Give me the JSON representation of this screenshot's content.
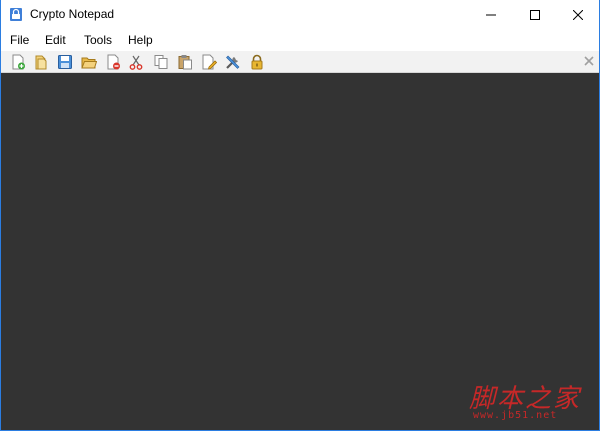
{
  "window": {
    "title": "Crypto Notepad",
    "controls": [
      "minimize-icon",
      "maximize-icon",
      "close-icon"
    ]
  },
  "menu": {
    "items": [
      {
        "label": "File"
      },
      {
        "label": "Edit"
      },
      {
        "label": "Tools"
      },
      {
        "label": "Help"
      }
    ]
  },
  "toolbar": {
    "buttons": [
      "new-file-icon",
      "open-file-icon",
      "save-icon",
      "open-folder-icon",
      "delete-file-icon",
      "cut-icon",
      "copy-icon",
      "paste-icon",
      "edit-document-icon",
      "settings-tools-icon",
      "lock-icon"
    ],
    "close_icon": "close-icon"
  },
  "editor": {
    "content": "",
    "background": "#333333"
  },
  "watermark": {
    "text": "脚本之家",
    "url": "www.jb51.net",
    "color": "#c62828"
  }
}
